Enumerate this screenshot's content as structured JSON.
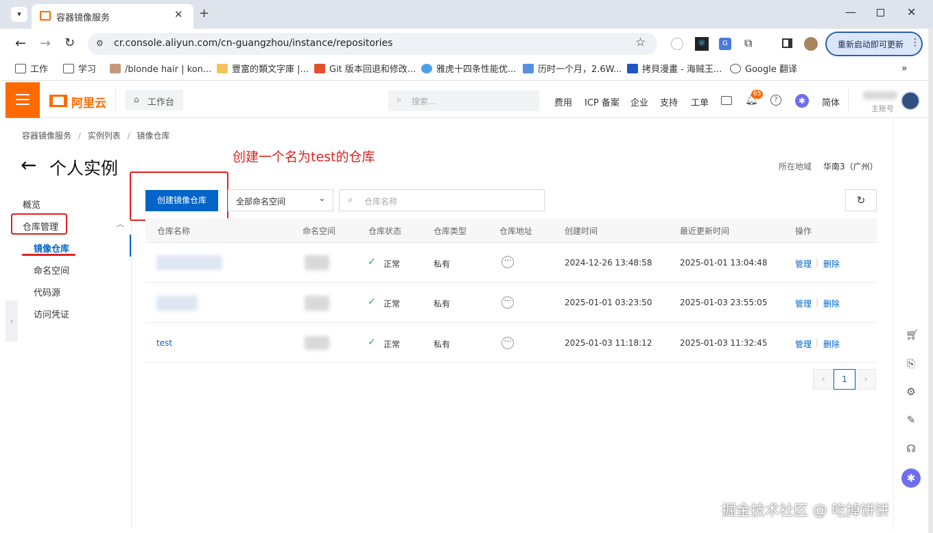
{
  "browser": {
    "tab_title": "容器镜像服务",
    "url": "cr.console.aliyun.com/cn-guangzhou/instance/repositories",
    "restart_button": "重新启动即可更新",
    "bookmarks": [
      "工作",
      "学习",
      "/blonde hair | kon...",
      "豐富的類文字庫 |...",
      "Git 版本回退和修改...",
      "雅虎十四条性能优...",
      "历时一个月，2.6W...",
      "拷貝漫畫 - 海贼王...",
      "Google 翻译"
    ]
  },
  "console": {
    "logo": "阿里云",
    "workbench": "工作台",
    "search_placeholder": "搜索...",
    "nav": [
      "费用",
      "ICP 备案",
      "企业",
      "支持",
      "工单"
    ],
    "notification_count": "65",
    "lang": "简体",
    "account_label": "主账号"
  },
  "breadcrumb": [
    "容器镜像服务",
    "实例列表",
    "镜像仓库"
  ],
  "page": {
    "title": "个人实例",
    "region_label": "所在地域",
    "region_value": "华南3（广州）"
  },
  "annotation": {
    "text": "创建一个名为test的仓库",
    "color": "#e02020"
  },
  "sidebar": {
    "overview": "概览",
    "group": "仓库管理",
    "items": [
      "镜像仓库",
      "命名空间",
      "代码源",
      "访问凭证"
    ]
  },
  "toolbar": {
    "create_button": "创建镜像仓库",
    "namespace_select": "全部命名空间",
    "search_placeholder": "仓库名称"
  },
  "table": {
    "columns": [
      "仓库名称",
      "命名空间",
      "仓库状态",
      "仓库类型",
      "仓库地址",
      "创建时间",
      "最近更新时间",
      "操作"
    ],
    "rows": [
      {
        "name": "",
        "status": "正常",
        "type": "私有",
        "created": "2024-12-26 13:48:58",
        "updated": "2025-01-01 13:04:48",
        "manage": "管理",
        "delete": "删除"
      },
      {
        "name": "",
        "status": "正常",
        "type": "私有",
        "created": "2025-01-01 03:23:50",
        "updated": "2025-01-03 23:55:05",
        "manage": "管理",
        "delete": "删除"
      },
      {
        "name": "test",
        "status": "正常",
        "type": "私有",
        "created": "2025-01-03 11:18:12",
        "updated": "2025-01-03 11:32:45",
        "manage": "管理",
        "delete": "删除"
      }
    ]
  },
  "pagination": {
    "current": "1"
  },
  "watermark": "掘金技术社区 @ 吃掉饼饼",
  "colors": {
    "accent": "#ff6a00",
    "primary": "#0064c8",
    "status_ok": "#23a35f"
  }
}
